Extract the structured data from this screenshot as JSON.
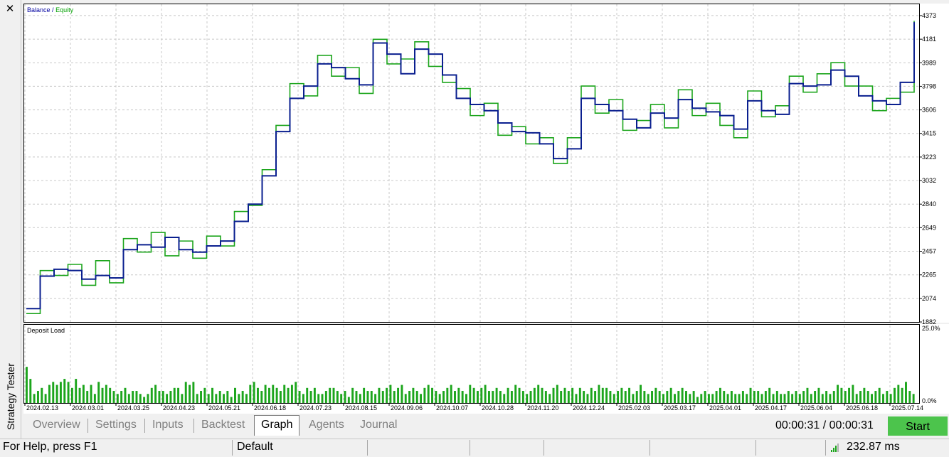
{
  "window": {
    "side_title": "Strategy Tester",
    "close_glyph": "✕"
  },
  "chart": {
    "legend_balance": "Balance",
    "legend_sep": "/",
    "legend_equity": "Equity",
    "load_title": "Deposit Load",
    "colors": {
      "balance": "#0a1f8f",
      "equity": "#1ca51c",
      "grid": "#c8c8c8",
      "load_bar": "#1ca51c"
    }
  },
  "chart_data": [
    {
      "type": "line",
      "title": "",
      "legend": [
        "Balance",
        "Equity"
      ],
      "ylim": [
        1882,
        4465
      ],
      "yticks": [
        "4373",
        "4181",
        "3989",
        "3798",
        "3606",
        "3415",
        "3223",
        "3032",
        "2840",
        "2649",
        "2457",
        "2265",
        "2074",
        "1882"
      ],
      "x_tick_labels": [
        "2024.02.13",
        "2024.03.01",
        "2024.03.25",
        "2024.04.23",
        "2024.05.21",
        "2024.06.18",
        "2024.07.23",
        "2024.08.15",
        "2024.09.06",
        "2024.10.07",
        "2024.10.28",
        "2024.11.20",
        "2024.12.24",
        "2025.02.03",
        "2025.03.17",
        "2025.04.01",
        "2025.04.17",
        "2025.06.04",
        "2025.06.18",
        "2025.07.14"
      ],
      "series": [
        {
          "name": "Balance",
          "points": [
            [
              0,
              1990
            ],
            [
              1,
              2255
            ],
            [
              2,
              2310
            ],
            [
              3,
              2300
            ],
            [
              4,
              2230
            ],
            [
              5,
              2260
            ],
            [
              6,
              2240
            ],
            [
              7,
              2470
            ],
            [
              8,
              2510
            ],
            [
              9,
              2490
            ],
            [
              10,
              2570
            ],
            [
              11,
              2470
            ],
            [
              12,
              2450
            ],
            [
              13,
              2500
            ],
            [
              14,
              2540
            ],
            [
              15,
              2700
            ],
            [
              16,
              2840
            ],
            [
              17,
              3070
            ],
            [
              18,
              3430
            ],
            [
              19,
              3700
            ],
            [
              20,
              3800
            ],
            [
              21,
              3980
            ],
            [
              22,
              3950
            ],
            [
              23,
              3860
            ],
            [
              24,
              3810
            ],
            [
              25,
              4150
            ],
            [
              26,
              4060
            ],
            [
              27,
              3900
            ],
            [
              28,
              4100
            ],
            [
              29,
              4060
            ],
            [
              30,
              3890
            ],
            [
              31,
              3700
            ],
            [
              32,
              3650
            ],
            [
              33,
              3600
            ],
            [
              34,
              3500
            ],
            [
              35,
              3430
            ],
            [
              36,
              3420
            ],
            [
              37,
              3330
            ],
            [
              38,
              3210
            ],
            [
              39,
              3290
            ],
            [
              40,
              3700
            ],
            [
              41,
              3650
            ],
            [
              42,
              3600
            ],
            [
              43,
              3530
            ],
            [
              44,
              3460
            ],
            [
              45,
              3580
            ],
            [
              46,
              3540
            ],
            [
              47,
              3690
            ],
            [
              48,
              3620
            ],
            [
              49,
              3590
            ],
            [
              50,
              3560
            ],
            [
              51,
              3450
            ],
            [
              52,
              3680
            ],
            [
              53,
              3600
            ],
            [
              54,
              3570
            ],
            [
              55,
              3820
            ],
            [
              56,
              3800
            ],
            [
              57,
              3810
            ],
            [
              58,
              3930
            ],
            [
              59,
              3880
            ],
            [
              60,
              3720
            ],
            [
              61,
              3680
            ],
            [
              62,
              3650
            ],
            [
              63,
              3830
            ],
            [
              64,
              4320
            ]
          ]
        },
        {
          "name": "Equity",
          "points": [
            [
              0,
              1950
            ],
            [
              1,
              2300
            ],
            [
              2,
              2260
            ],
            [
              3,
              2350
            ],
            [
              4,
              2180
            ],
            [
              5,
              2380
            ],
            [
              6,
              2200
            ],
            [
              7,
              2560
            ],
            [
              8,
              2450
            ],
            [
              9,
              2610
            ],
            [
              10,
              2420
            ],
            [
              11,
              2540
            ],
            [
              12,
              2400
            ],
            [
              13,
              2580
            ],
            [
              14,
              2500
            ],
            [
              15,
              2780
            ],
            [
              16,
              2830
            ],
            [
              17,
              3120
            ],
            [
              18,
              3480
            ],
            [
              19,
              3820
            ],
            [
              20,
              3720
            ],
            [
              21,
              4050
            ],
            [
              22,
              3880
            ],
            [
              23,
              3950
            ],
            [
              24,
              3740
            ],
            [
              25,
              4180
            ],
            [
              26,
              3980
            ],
            [
              27,
              4020
            ],
            [
              28,
              4160
            ],
            [
              29,
              3960
            ],
            [
              30,
              3830
            ],
            [
              31,
              3780
            ],
            [
              32,
              3560
            ],
            [
              33,
              3660
            ],
            [
              34,
              3400
            ],
            [
              35,
              3470
            ],
            [
              36,
              3330
            ],
            [
              37,
              3380
            ],
            [
              38,
              3170
            ],
            [
              39,
              3380
            ],
            [
              40,
              3800
            ],
            [
              41,
              3580
            ],
            [
              42,
              3690
            ],
            [
              43,
              3440
            ],
            [
              44,
              3520
            ],
            [
              45,
              3650
            ],
            [
              46,
              3460
            ],
            [
              47,
              3770
            ],
            [
              48,
              3560
            ],
            [
              49,
              3660
            ],
            [
              50,
              3480
            ],
            [
              51,
              3380
            ],
            [
              52,
              3760
            ],
            [
              53,
              3550
            ],
            [
              54,
              3640
            ],
            [
              55,
              3880
            ],
            [
              56,
              3750
            ],
            [
              57,
              3900
            ],
            [
              58,
              3990
            ],
            [
              59,
              3800
            ],
            [
              60,
              3800
            ],
            [
              61,
              3600
            ],
            [
              62,
              3700
            ],
            [
              63,
              3750
            ],
            [
              64,
              4330
            ]
          ]
        }
      ]
    },
    {
      "type": "bar",
      "title": "Deposit Load",
      "ylim": [
        0,
        25
      ],
      "yticks": [
        "25.0%",
        "0.0%"
      ],
      "unit": "%",
      "values": [
        12,
        8,
        3,
        4,
        5,
        3,
        6,
        7,
        6,
        7,
        8,
        7,
        5,
        8,
        5,
        6,
        4,
        6,
        3,
        7,
        5,
        6,
        5,
        4,
        3,
        4,
        5,
        3,
        4,
        4,
        3,
        2,
        3,
        5,
        6,
        4,
        4,
        3,
        4,
        5,
        5,
        3,
        7,
        6,
        7,
        3,
        4,
        5,
        3,
        5,
        3,
        4,
        3,
        4,
        2,
        5,
        3,
        4,
        3,
        6,
        7,
        5,
        4,
        6,
        5,
        6,
        5,
        4,
        6,
        5,
        6,
        7,
        4,
        3,
        5,
        4,
        5,
        3,
        3,
        4,
        5,
        5,
        4,
        3,
        4,
        2,
        5,
        4,
        3,
        5,
        4,
        4,
        3,
        5,
        4,
        5,
        6,
        4,
        5,
        6,
        3,
        4,
        5,
        4,
        3,
        5,
        6,
        5,
        4,
        3,
        4,
        5,
        6,
        4,
        5,
        4,
        3,
        6,
        5,
        4,
        5,
        6,
        4,
        4,
        5,
        4,
        3,
        5,
        4,
        6,
        5,
        4,
        3,
        4,
        5,
        6,
        5,
        4,
        3,
        5,
        6,
        4,
        5,
        4,
        5,
        3,
        5,
        4,
        3,
        5,
        4,
        6,
        5,
        5,
        4,
        3,
        4,
        5,
        4,
        5,
        3,
        4,
        6,
        4,
        3,
        4,
        5,
        4,
        3,
        4,
        5,
        3,
        4,
        5,
        4,
        3,
        4,
        2,
        3,
        4,
        3,
        3,
        4,
        5,
        4,
        3,
        4,
        3,
        3,
        4,
        3,
        5,
        4,
        4,
        3,
        4,
        5,
        3,
        4,
        3,
        3,
        4,
        3,
        4,
        3,
        4,
        5,
        3,
        4,
        5,
        3,
        4,
        3,
        4,
        6,
        5,
        4,
        5,
        6,
        3,
        4,
        5,
        4,
        3,
        4,
        5,
        3,
        4,
        3,
        5,
        6,
        5,
        7,
        4,
        3
      ]
    }
  ],
  "tabs": [
    "Overview",
    "Settings",
    "Inputs",
    "Backtest",
    "Graph",
    "Agents",
    "Journal"
  ],
  "active_tab": "Graph",
  "timer": "00:00:31 / 00:00:31",
  "start_label": "Start",
  "status": {
    "help": "For Help, press F1",
    "profile": "Default",
    "ping": "232.87 ms"
  }
}
